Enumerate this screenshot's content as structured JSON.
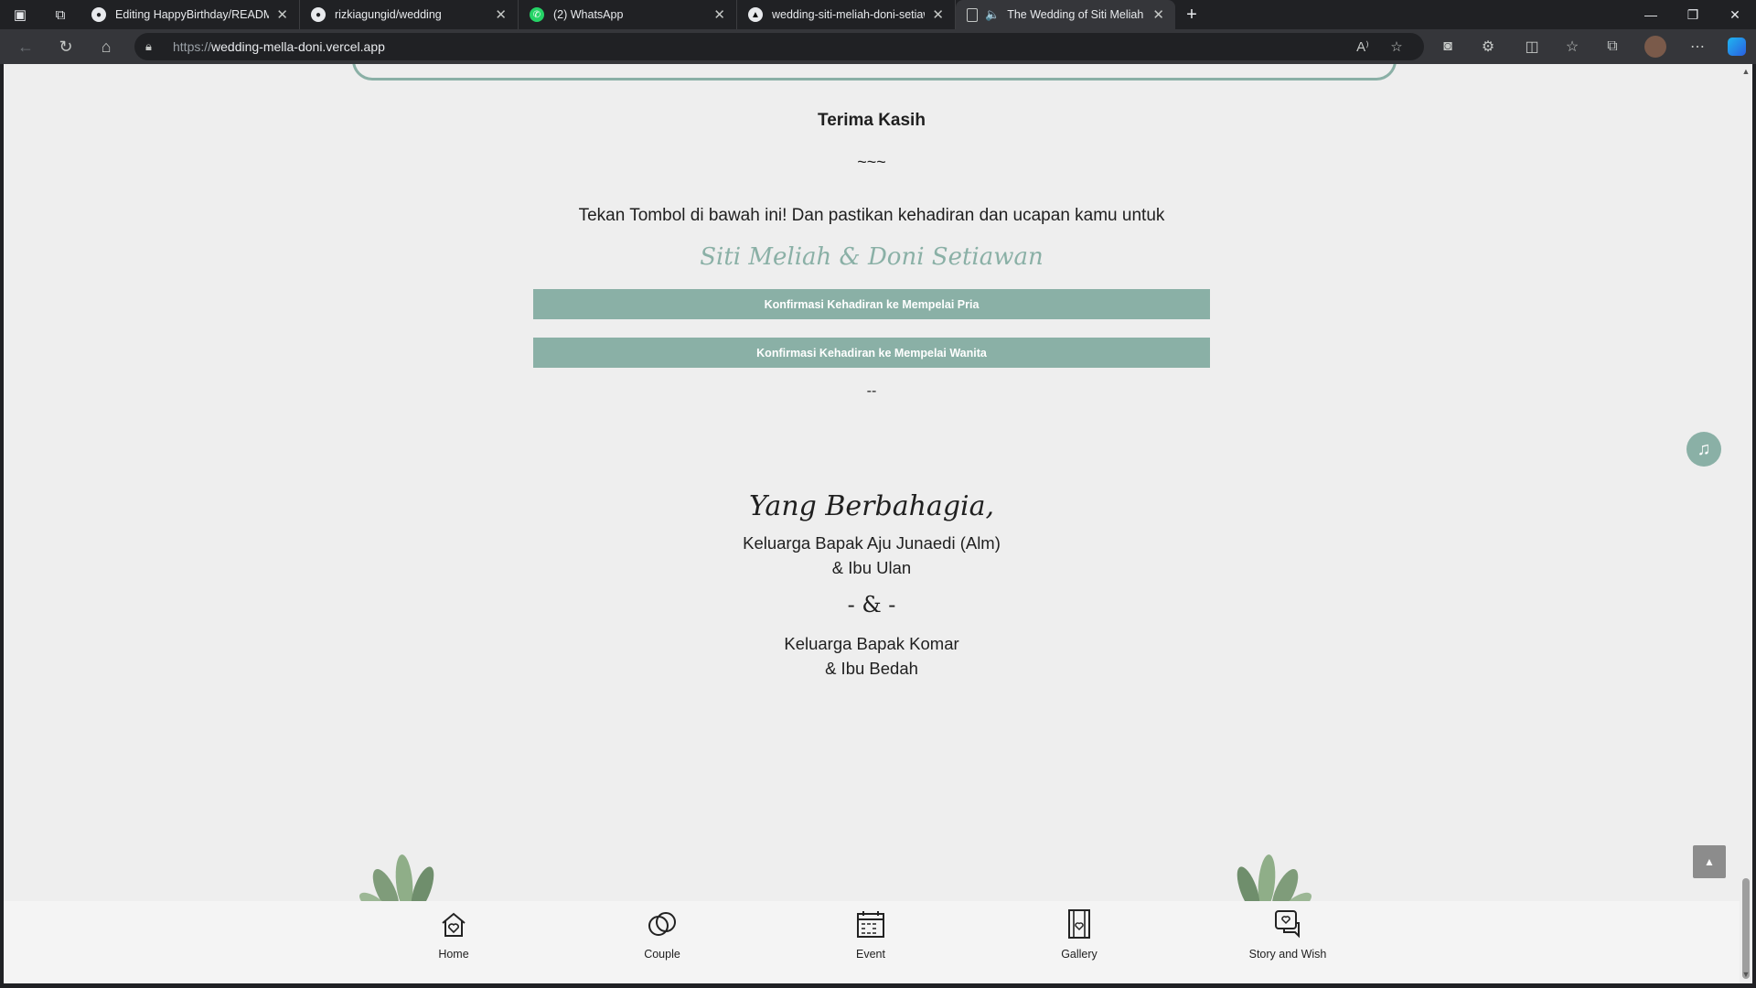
{
  "browser": {
    "tabs": [
      {
        "title": "Editing HappyBirthday/README",
        "icon": "github-icon",
        "active": false
      },
      {
        "title": "rizkiagungid/wedding",
        "icon": "github-icon",
        "active": false
      },
      {
        "title": "(2) WhatsApp",
        "icon": "whatsapp-icon",
        "active": false
      },
      {
        "title": "wedding-siti-meliah-doni-setiaw",
        "icon": "vercel-icon",
        "active": false
      },
      {
        "title": "The Wedding of Siti Meliah",
        "icon": "page-icon",
        "active": true
      }
    ],
    "url_scheme": "https://",
    "url_host": "wedding-mella-doni.vercel.app"
  },
  "page": {
    "thanks_title": "Terima Kasih",
    "tilde": "~~~",
    "prompt": "Tekan Tombol di bawah ini! Dan pastikan kehadiran dan ucapan kamu untuk",
    "couple_names": "Siti Meliah & Doni Setiawan",
    "rsvp_groom_label": "Konfirmasi Kehadiran ke Mempelai Pria",
    "rsvp_bride_label": "Konfirmasi Kehadiran ke Mempelai Wanita",
    "dash": "--",
    "happy_title": "Yang Berbahagia,",
    "family1_line1": "Keluarga Bapak Aju Junaedi (Alm)",
    "family1_line2": "& Ibu Ulan",
    "amp": "- & -",
    "family2_line1": "Keluarga Bapak Komar",
    "family2_line2": "& Ibu Bedah"
  },
  "bottom_nav": [
    {
      "label": "Home",
      "icon": "home-heart-icon"
    },
    {
      "label": "Couple",
      "icon": "rings-icon"
    },
    {
      "label": "Event",
      "icon": "calendar-icon"
    },
    {
      "label": "Gallery",
      "icon": "film-icon"
    },
    {
      "label": "Story and Wish",
      "icon": "chat-heart-icon"
    }
  ],
  "colors": {
    "accent": "#8ab0a6",
    "page_bg": "#eeeeee"
  }
}
